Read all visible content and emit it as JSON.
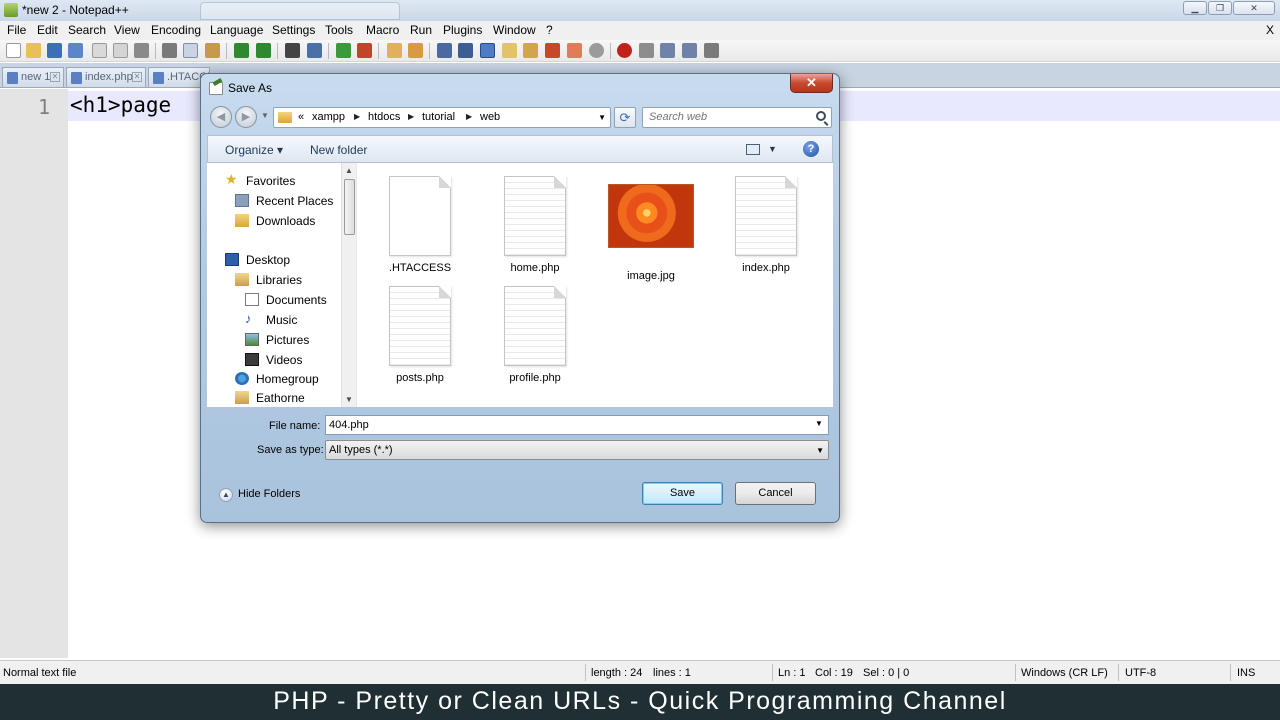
{
  "window": {
    "title": "*new 2 - Notepad++",
    "close_glyph": "X"
  },
  "menu": [
    "File",
    "Edit",
    "Search",
    "View",
    "Encoding",
    "Language",
    "Settings",
    "Tools",
    "Macro",
    "Run",
    "Plugins",
    "Window",
    "?"
  ],
  "tabs": [
    {
      "label": "new 1"
    },
    {
      "label": "index.php"
    },
    {
      "label": ".HTACCESS"
    }
  ],
  "editor": {
    "line_number": "1",
    "code": "<h1>page "
  },
  "dialog": {
    "title": "Save As",
    "close_glyph": "✕",
    "breadcrumb": [
      "«",
      "xampp",
      "htdocs",
      "tutorial",
      "web"
    ],
    "search_placeholder": "Search web",
    "organize_label": "Organize ▾",
    "new_folder_label": "New folder",
    "nav_items": [
      {
        "label": "Favorites",
        "icon": "star-icon"
      },
      {
        "label": "Recent Places",
        "icon": "recent-places-icon"
      },
      {
        "label": "Downloads",
        "icon": "downloads-icon"
      },
      {
        "label": "Desktop",
        "icon": "desktop-icon"
      },
      {
        "label": "Libraries",
        "icon": "libraries-icon"
      },
      {
        "label": "Documents",
        "icon": "documents-icon"
      },
      {
        "label": "Music",
        "icon": "music-icon"
      },
      {
        "label": "Pictures",
        "icon": "pictures-icon"
      },
      {
        "label": "Videos",
        "icon": "videos-icon"
      },
      {
        "label": "Homegroup",
        "icon": "homegroup-icon"
      },
      {
        "label": "Eathorne",
        "icon": "user-folder-icon"
      }
    ],
    "files": [
      {
        "name": ".HTACCESS",
        "kind": "blank"
      },
      {
        "name": "home.php",
        "kind": "text"
      },
      {
        "name": "image.jpg",
        "kind": "image"
      },
      {
        "name": "index.php",
        "kind": "text"
      },
      {
        "name": "posts.php",
        "kind": "text"
      },
      {
        "name": "profile.php",
        "kind": "text"
      }
    ],
    "file_name_label": "File name:",
    "file_name_value": "404.php",
    "save_type_label": "Save as type:",
    "save_type_value": "All types (*.*)",
    "hide_folders_label": "Hide Folders",
    "save_label": "Save",
    "cancel_label": "Cancel"
  },
  "status": {
    "type": "Normal text file",
    "length": "length : 24",
    "lines": "lines : 1",
    "ln": "Ln : 1",
    "col": "Col : 19",
    "sel": "Sel : 0 | 0",
    "eol": "Windows (CR LF)",
    "encoding": "UTF-8",
    "mode": "INS"
  },
  "caption": "PHP - Pretty or Clean URLs - Quick Programming Channel"
}
